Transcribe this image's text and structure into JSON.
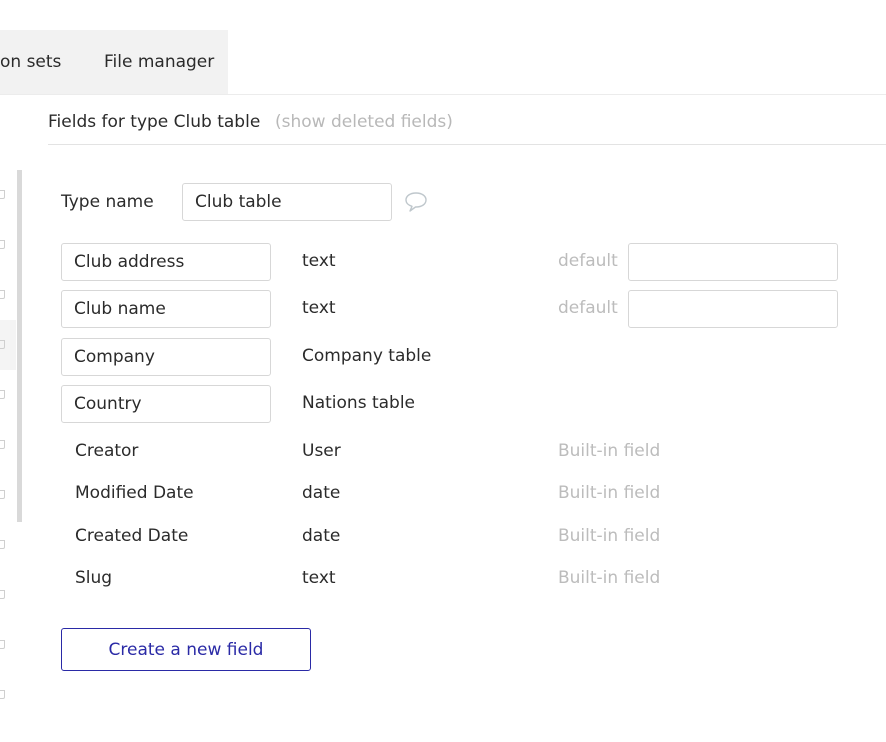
{
  "tabs": [
    {
      "label": "on sets"
    },
    {
      "label": "File manager"
    }
  ],
  "header": {
    "title": "Fields for type Club table",
    "show_deleted": "(show deleted fields)"
  },
  "type_name": {
    "label": "Type name",
    "value": "Club table",
    "comment_icon": "speech-bubble-icon"
  },
  "fields": [
    {
      "name": "Club address",
      "type": "text",
      "default_label": "default",
      "default_value": ""
    },
    {
      "name": "Club name",
      "type": "text",
      "default_label": "default",
      "default_value": ""
    },
    {
      "name": "Company",
      "type": "Company table"
    },
    {
      "name": "Country",
      "type": "Nations table"
    }
  ],
  "builtin_fields": [
    {
      "name": "Creator",
      "type": "User",
      "note": "Built-in field"
    },
    {
      "name": "Modified Date",
      "type": "date",
      "note": "Built-in field"
    },
    {
      "name": "Created Date",
      "type": "date",
      "note": "Built-in field"
    },
    {
      "name": "Slug",
      "type": "text",
      "note": "Built-in field"
    }
  ],
  "create_button": {
    "label": "Create a new field"
  },
  "colors": {
    "accent": "#2a2aa6",
    "muted_text": "#bcbcbc",
    "tab_background": "#f2f2f2",
    "border": "#d7d7d7"
  }
}
